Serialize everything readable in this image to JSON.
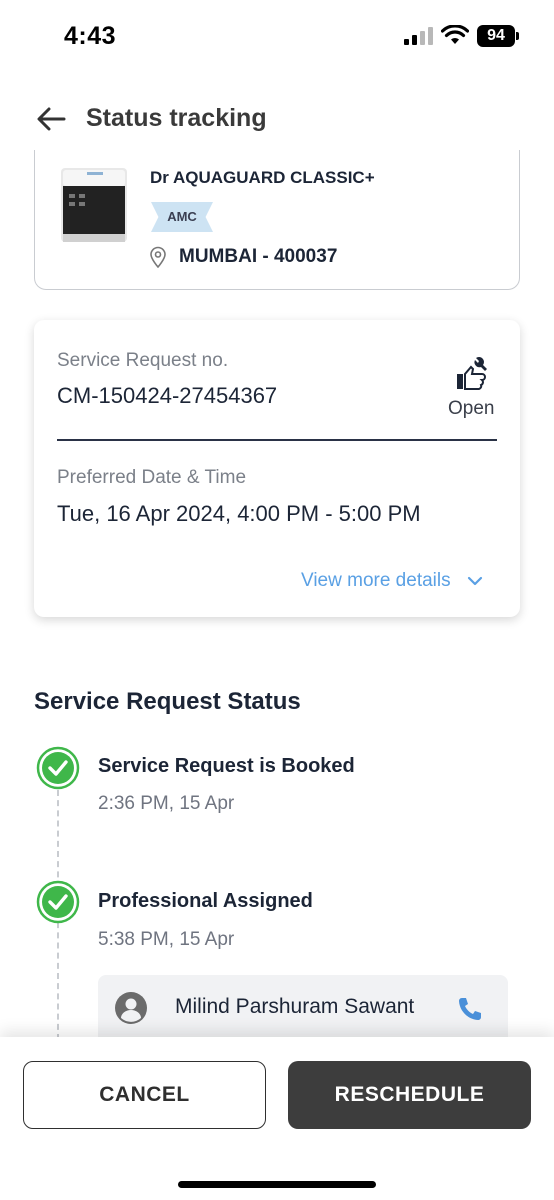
{
  "status_bar": {
    "time": "4:43",
    "battery": "94"
  },
  "header": {
    "title": "Status tracking",
    "back_icon": "arrow-left-icon"
  },
  "product": {
    "name": "Dr AQUAGUARD CLASSIC+",
    "badge": "AMC",
    "location": "MUMBAI - 400037"
  },
  "request": {
    "sr_label": "Service Request no.",
    "sr_number": "CM-150424-27454367",
    "status": "Open",
    "status_icon": "thumbs-up-wrench-icon",
    "preferred_label": "Preferred Date & Time",
    "preferred_value": "Tue, 16 Apr 2024, 4:00 PM - 5:00 PM",
    "view_more": "View more details"
  },
  "status_section": {
    "title": "Service Request Status",
    "steps": [
      {
        "title": "Service Request is Booked",
        "time": "2:36 PM, 15 Apr"
      },
      {
        "title": "Professional Assigned",
        "time": "5:38 PM, 15 Apr"
      }
    ],
    "professional": {
      "name": "Milind Parshuram Sawant"
    }
  },
  "actions": {
    "cancel": "CANCEL",
    "reschedule": "RESCHEDULE"
  },
  "colors": {
    "accent_link": "#5aa0e4",
    "success_green": "#3fb74a",
    "primary_button": "#3d3d3d"
  }
}
